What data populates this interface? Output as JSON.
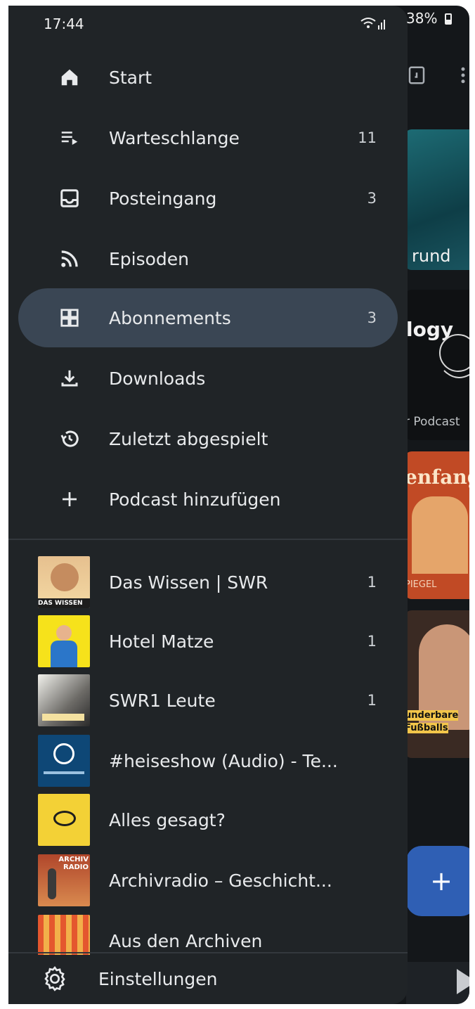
{
  "status_bar": {
    "time": "17:44",
    "battery": "38%"
  },
  "nav": [
    {
      "label": "Start",
      "count": "",
      "icon": "home-icon"
    },
    {
      "label": "Warteschlange",
      "count": "11",
      "icon": "queue-icon"
    },
    {
      "label": "Posteingang",
      "count": "3",
      "icon": "inbox-icon"
    },
    {
      "label": "Episoden",
      "count": "",
      "icon": "rss-icon"
    },
    {
      "label": "Abonnements",
      "count": "3",
      "icon": "grid-icon",
      "active": true
    },
    {
      "label": "Downloads",
      "count": "",
      "icon": "download-icon"
    },
    {
      "label": "Zuletzt abgespielt",
      "count": "",
      "icon": "history-icon"
    },
    {
      "label": "Podcast hinzufügen",
      "count": "",
      "icon": "add-icon"
    }
  ],
  "subscriptions": [
    {
      "label": "Das Wissen | SWR",
      "count": "1",
      "thumb_text": "DAS WISSEN"
    },
    {
      "label": "Hotel Matze",
      "count": "1",
      "thumb_text": ""
    },
    {
      "label": "SWR1 Leute",
      "count": "1",
      "thumb_text": ""
    },
    {
      "label": "#heiseshow (Audio) - Te...",
      "count": "",
      "thumb_text": ""
    },
    {
      "label": "Alles gesagt?",
      "count": "",
      "thumb_text": ""
    },
    {
      "label": "Archivradio – Geschicht...",
      "count": "",
      "thumb_text": "ARCHIV RADIO"
    },
    {
      "label": "Aus den Archiven",
      "count": "",
      "thumb_text": ""
    }
  ],
  "settings": {
    "label": "Einstellungen"
  },
  "background": {
    "tile_texts": [
      "rund",
      "logy",
      "r Podcast",
      "enfang",
      "PIEGEL",
      "underbare",
      "Fußballs"
    ]
  },
  "colors": {
    "drawer": "#202427",
    "active": "#3a4654",
    "fab": "#2f5fb4"
  }
}
